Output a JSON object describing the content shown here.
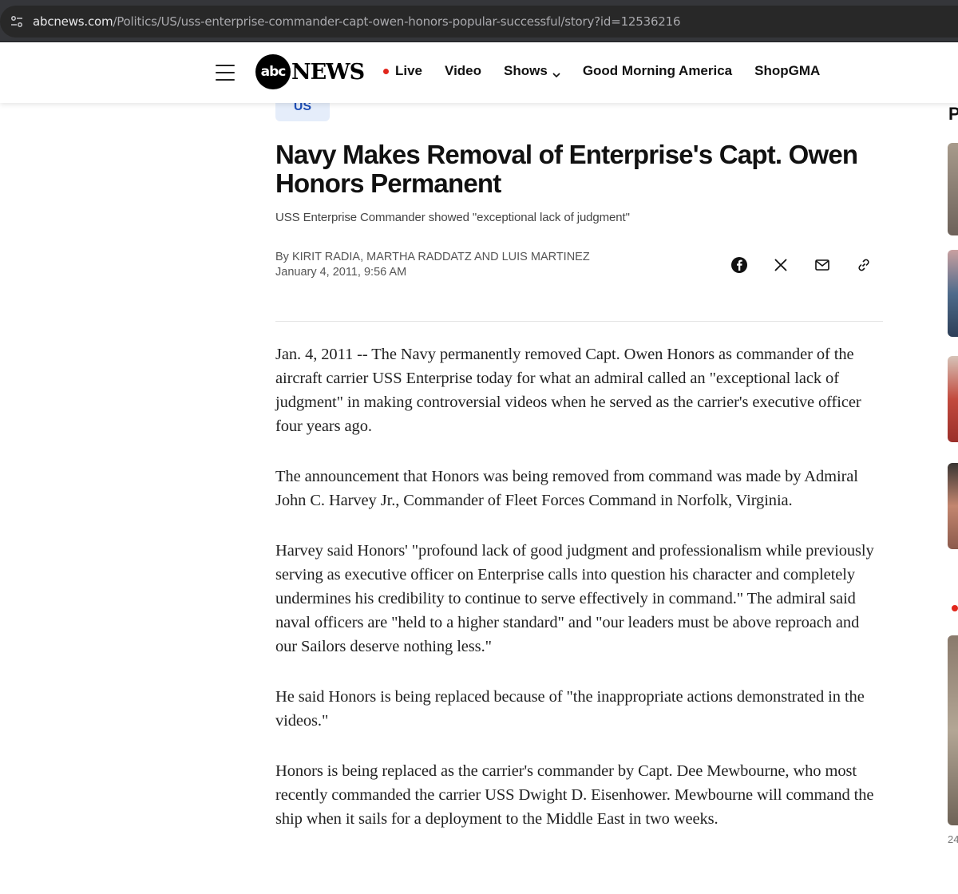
{
  "browser": {
    "url_host": "abcnews.com",
    "url_path": "/Politics/US/uss-enterprise-commander-capt-owen-honors-popular-successful/story?id=12536216"
  },
  "header": {
    "logo_mark": "abc",
    "logo_text": "NEWS",
    "nav": {
      "live": "Live",
      "video": "Video",
      "shows": "Shows",
      "gma": "Good Morning America",
      "shop": "ShopGMA"
    }
  },
  "article": {
    "category": "US",
    "headline": "Navy Makes Removal of Enterprise's Capt. Owen Honors Permanent",
    "subhead": "USS Enterprise Commander showed \"exceptional lack of judgment\"",
    "byline_prefix": "By ",
    "authors": "Kirit Radia, Martha Raddatz and Luis Martinez",
    "date": "January 4, 2011, 9:56 AM",
    "paragraphs": [
      "Jan. 4, 2011 -- The Navy permanently removed Capt. Owen Honors as commander of the aircraft carrier USS Enterprise today for what an admiral called an \"exceptional lack of judgment\" in making controversial videos when he served as the carrier's executive officer four years ago.",
      "The announcement that Honors was being removed from command was made by Admiral John C. Harvey Jr., Commander of Fleet Forces Command in Norfolk, Virginia.",
      "Harvey said Honors' \"profound lack of good judgment and professionalism while previously serving as executive officer on Enterprise calls into question his character and completely undermines his credibility to continue to serve effectively in command.\" The admiral said naval officers are \"held to a higher standard\" and \"our leaders must be above reproach and our Sailors deserve nothing less.\"",
      "He said Honors is being replaced because of \"the inappropriate actions demonstrated in the videos.\"",
      "Honors is being replaced as the carrier's commander by Capt. Dee Mewbourne, who most recently commanded the carrier USS Dwight D. Eisenhower. Mewbourne will command the ship when it sails for a deployment to the Middle East in two weeks."
    ]
  },
  "rail": {
    "title_fragment": "P",
    "timestamp_fragment": "24"
  },
  "icons": {
    "site_info": "tune-icon",
    "menu": "hamburger-icon",
    "live": "live-dot-icon",
    "shows": "chevron-down-icon",
    "share": [
      "facebook-icon",
      "x-icon",
      "email-icon",
      "link-icon"
    ]
  },
  "colors": {
    "live_red": "#e1261c",
    "category_bg": "#e5edfa",
    "category_text": "#1f4fb6"
  }
}
